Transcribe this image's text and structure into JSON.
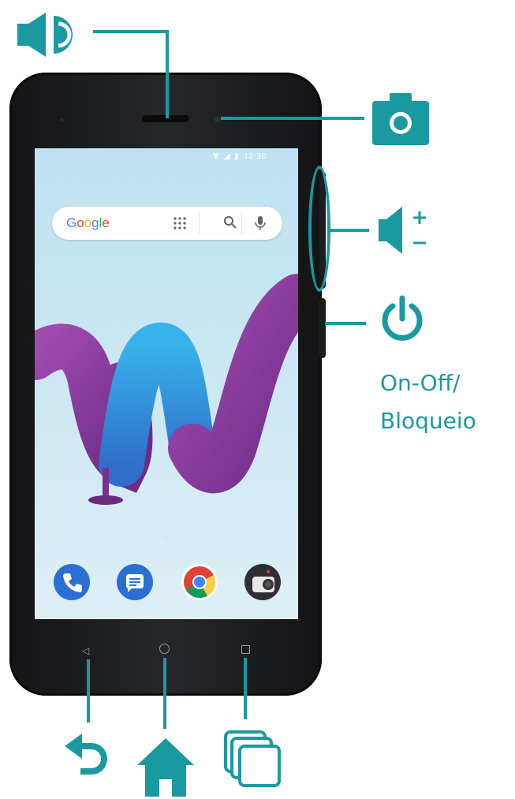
{
  "status_bar": {
    "time": "12:30"
  },
  "search": {
    "brand": [
      "G",
      "o",
      "o",
      "g",
      "l",
      "e"
    ]
  },
  "labels": {
    "power": "On-Off/",
    "lock": "Bloqueio"
  },
  "colors": {
    "accent": "#1a9aa0",
    "wallpaper_purple": "#8d3a9e",
    "wallpaper_blue": "#2f9fe0"
  },
  "icons": {
    "speaker": "speaker-icon",
    "camera": "camera-icon",
    "volume": "volume-icon",
    "power": "power-icon",
    "back": "back-icon",
    "home": "home-icon",
    "recent": "recent-apps-icon"
  },
  "dock": [
    "phone-app",
    "messages-app",
    "chrome-app",
    "camera-app"
  ]
}
